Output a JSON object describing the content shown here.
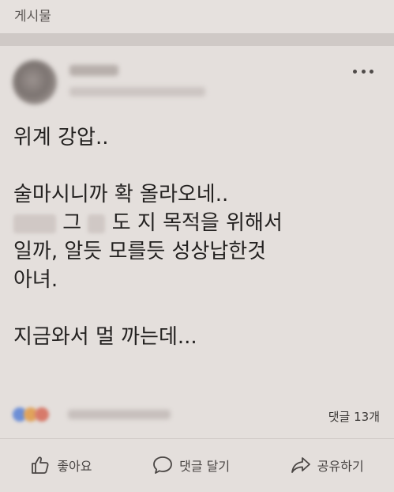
{
  "header": {
    "title": "게시물"
  },
  "post": {
    "body_lines": [
      "위계 강압..",
      "",
      "술마시니까 확 올라오네..",
      "",
      "일까, 알듯 모를듯 성상납한것",
      "아녀.",
      "",
      "지금와서 멀 까는데..."
    ],
    "redacted_line": {
      "part_a": "그",
      "part_b": "도 지 목적을 위해서"
    }
  },
  "stats": {
    "comment_count": "댓글 13개"
  },
  "actions": {
    "like": "좋아요",
    "comment": "댓글 달기",
    "share": "공유하기"
  },
  "icons": {
    "more": "more-dots-icon",
    "like": "thumbs-up-icon",
    "comment": "speech-bubble-icon",
    "share": "share-arrow-icon"
  },
  "colors": {
    "background": "#dcd6d3",
    "card": "#e4dfdc",
    "text": "#232120",
    "muted": "#4a4644"
  }
}
